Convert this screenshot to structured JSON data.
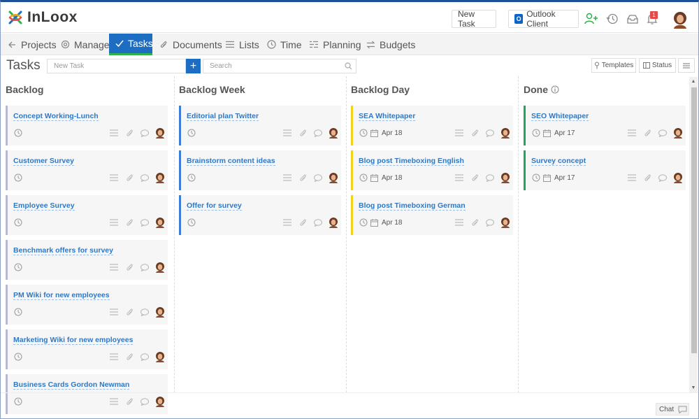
{
  "app": {
    "logo_text": "InLoox"
  },
  "header": {
    "new_task_label": "New Task",
    "outlook_label": "Outlook Client",
    "notification_count": "1"
  },
  "nav": {
    "items": [
      {
        "label": "Projects",
        "icon": "arrow-left-icon"
      },
      {
        "label": "Manage",
        "icon": "gear-icon"
      },
      {
        "label": "Tasks",
        "icon": "check-icon",
        "active": true
      },
      {
        "label": "Documents",
        "icon": "paperclip-icon"
      },
      {
        "label": "Lists",
        "icon": "list-icon"
      },
      {
        "label": "Time",
        "icon": "clock-icon"
      },
      {
        "label": "Planning",
        "icon": "planning-icon"
      },
      {
        "label": "Budgets",
        "icon": "transfer-icon"
      }
    ]
  },
  "page": {
    "title": "Tasks",
    "new_task_placeholder": "New Task",
    "search_placeholder": "Search",
    "templates_label": "Templates",
    "status_label": "Status"
  },
  "colors": {
    "accent": "#1d6ec2",
    "active_underline": "#2db24a",
    "backlog": "#b8b8d0",
    "week": "#3b7dd8",
    "day": "#f2d21b",
    "done": "#1fa463",
    "link": "#2f78c4"
  },
  "columns": [
    {
      "title": "Backlog",
      "cards": [
        {
          "title": "Concept Working-Lunch",
          "date": ""
        },
        {
          "title": "Customer Survey",
          "date": ""
        },
        {
          "title": "Employee Survey",
          "date": ""
        },
        {
          "title": "Benchmark offers for survey",
          "date": ""
        },
        {
          "title": "PM Wiki for new employees",
          "date": ""
        },
        {
          "title": "Marketing Wiki for new employees",
          "date": ""
        },
        {
          "title": "Business Cards Gordon Newman",
          "date": ""
        }
      ]
    },
    {
      "title": "Backlog Week",
      "cards": [
        {
          "title": "Editorial plan Twitter",
          "date": ""
        },
        {
          "title": "Brainstorm content ideas",
          "date": ""
        },
        {
          "title": "Offer for survey",
          "date": ""
        }
      ]
    },
    {
      "title": "Backlog Day",
      "cards": [
        {
          "title": "SEA Whitepaper",
          "date": "Apr 18"
        },
        {
          "title": "Blog post Timeboxing English",
          "date": "Apr 18"
        },
        {
          "title": "Blog post Timeboxing German",
          "date": "Apr 18"
        }
      ]
    },
    {
      "title": "Done",
      "cards": [
        {
          "title": "SEO Whitepaper",
          "date": "Apr 17"
        },
        {
          "title": "Survey concept",
          "date": "Apr 17"
        }
      ]
    }
  ],
  "footer": {
    "chat_label": "Chat"
  }
}
